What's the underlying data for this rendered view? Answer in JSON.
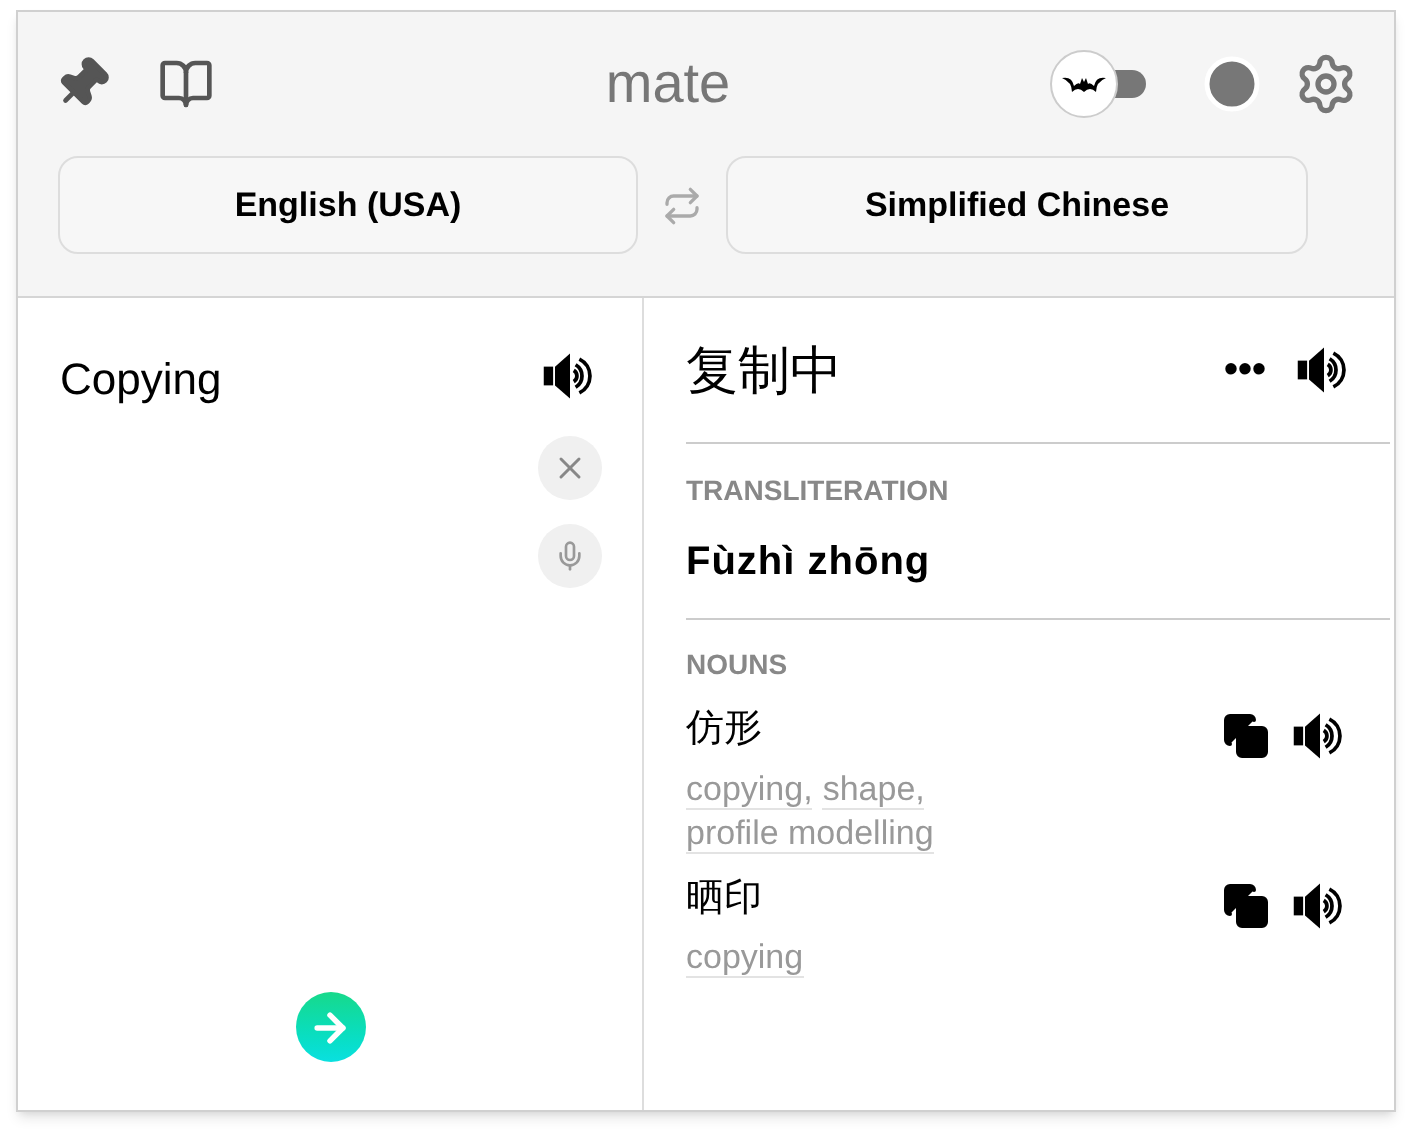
{
  "header": {
    "title": "mate",
    "toggle": {
      "on": false
    }
  },
  "languages": {
    "source": "English (USA)",
    "target": "Simplified Chinese"
  },
  "source": {
    "text": "Copying"
  },
  "result": {
    "text": "复制中",
    "more": "•••"
  },
  "transliteration": {
    "heading": "TRANSLITERATION",
    "text": "Fùzhì zhōng"
  },
  "nouns": {
    "heading": "NOUNS",
    "entries": [
      {
        "word": "仿形",
        "meanings": [
          "copying,",
          "shape,",
          "profile modelling"
        ]
      },
      {
        "word": "晒印",
        "meanings": [
          "copying"
        ]
      }
    ]
  }
}
